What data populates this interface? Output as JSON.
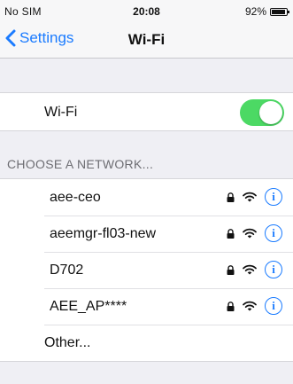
{
  "status_bar": {
    "carrier": "No SIM",
    "time": "20:08",
    "battery_percent_label": "92%",
    "battery_level": 0.92
  },
  "nav": {
    "back_label": "Settings",
    "title": "Wi-Fi"
  },
  "wifi": {
    "label": "Wi-Fi",
    "enabled": true,
    "toggle_color": "#4cd964"
  },
  "networks_section": {
    "header": "CHOOSE A NETWORK...",
    "networks": [
      {
        "name": "aee-ceo",
        "secured": true,
        "icons": [
          "lock-icon",
          "wifi-icon",
          "info-icon"
        ]
      },
      {
        "name": "aeemgr-fl03-new",
        "secured": true,
        "icons": [
          "lock-icon",
          "wifi-icon",
          "info-icon"
        ]
      },
      {
        "name": "D702",
        "secured": true,
        "icons": [
          "lock-icon",
          "wifi-icon",
          "info-icon"
        ]
      },
      {
        "name": "AEE_AP****",
        "secured": true,
        "icons": [
          "lock-icon",
          "wifi-icon",
          "info-icon"
        ]
      }
    ],
    "other_label": "Other..."
  },
  "colors": {
    "accent": "#1a7bff",
    "background": "#efeff4"
  }
}
